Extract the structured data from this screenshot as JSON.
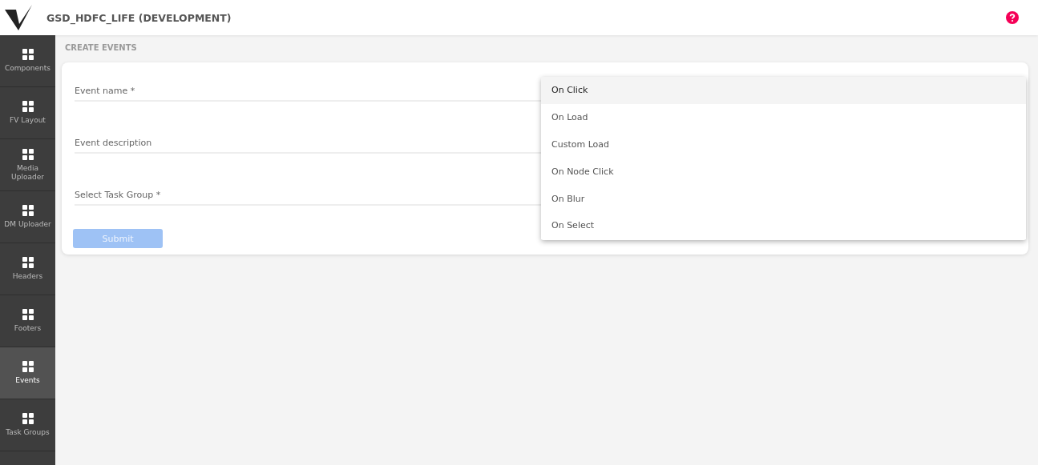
{
  "header": {
    "title": "GSD_HDFC_LIFE (DEVELOPMENT)"
  },
  "sidebar": {
    "items": [
      {
        "label": "Components",
        "selected": false
      },
      {
        "label": "FV Layout",
        "selected": false
      },
      {
        "label": "Media Uploader",
        "selected": false
      },
      {
        "label": "DM Uploader",
        "selected": false
      },
      {
        "label": "Headers",
        "selected": false
      },
      {
        "label": "Footers",
        "selected": false
      },
      {
        "label": "Events",
        "selected": true
      },
      {
        "label": "Task Groups",
        "selected": false
      }
    ]
  },
  "page_title": "CREATE EVENTS",
  "form": {
    "fields": [
      {
        "label": "Event name *"
      },
      {
        "label": "Event description"
      },
      {
        "label": "Select Task Group *"
      }
    ],
    "submit": {
      "label": "Submit",
      "disabled": true
    },
    "select_type": {
      "options": [
        {
          "label": "On Click",
          "selected": true
        },
        {
          "label": "On Load",
          "selected": false
        },
        {
          "label": "Custom Load",
          "selected": false
        },
        {
          "label": "On Node Click",
          "selected": false
        },
        {
          "label": "On Blur",
          "selected": false
        },
        {
          "label": "On Select",
          "selected": false
        }
      ]
    }
  }
}
